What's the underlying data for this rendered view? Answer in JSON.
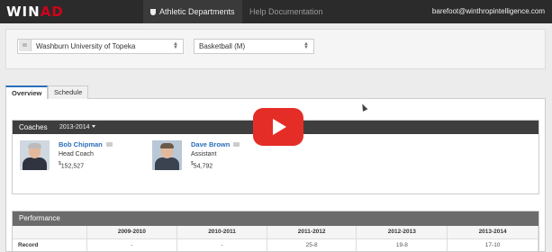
{
  "logo": {
    "prefix": "WIN",
    "suffix": "AD"
  },
  "nav": {
    "department_label": "Athletic Departments",
    "help_label": "Help Documentation",
    "user_email": "barefoot@winthropintelligence.com"
  },
  "filters": {
    "school": "Washburn University of Topeka",
    "sport": "Basketball (M)"
  },
  "tabs": [
    {
      "label": "Overview",
      "active": true
    },
    {
      "label": "Schedule",
      "active": false
    }
  ],
  "coaches": {
    "title": "Coaches",
    "season": "2013-2014",
    "list": [
      {
        "name": "Bob Chipman",
        "role": "Head Coach",
        "salary_symbol": "$",
        "salary": "152,527"
      },
      {
        "name": "Dave Brown",
        "role": "Assistant",
        "salary_symbol": "$",
        "salary": "54,792"
      }
    ]
  },
  "performance": {
    "title": "Performance",
    "columns": [
      "",
      "2009-2010",
      "2010-2011",
      "2011-2012",
      "2012-2013",
      "2013-2014"
    ],
    "rows": [
      {
        "label": "Record",
        "values": [
          "-",
          "-",
          "25-8",
          "19-8",
          "17-10"
        ]
      }
    ]
  },
  "colors": {
    "nav_bg": "#2b2b2b",
    "logo_accent": "#d0021b",
    "link": "#2a6ebb",
    "play_button": "#e52d27"
  },
  "icons": [
    "shield-icon",
    "caret-down-icon",
    "lock-icon",
    "chat-icon",
    "play-icon"
  ]
}
